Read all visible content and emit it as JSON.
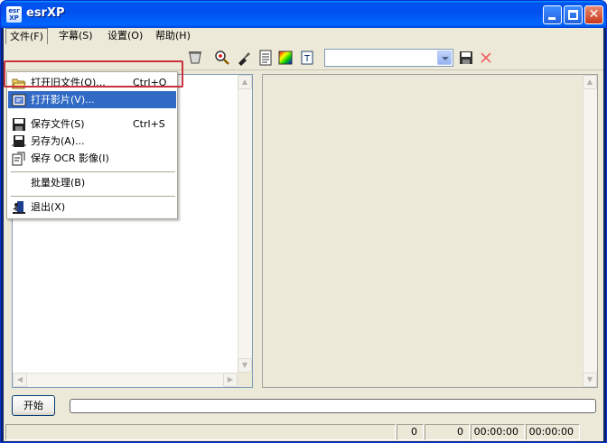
{
  "window": {
    "title": "esrXP",
    "icon_text": "esr XP"
  },
  "menubar": {
    "items": [
      {
        "label": "文件(F)"
      },
      {
        "label": "字幕(S)"
      },
      {
        "label": "设置(O)"
      },
      {
        "label": "帮助(H)"
      }
    ]
  },
  "toolbar": {
    "icons": [
      "clear-icon",
      "zoom-in-icon",
      "brush-icon",
      "document-icon",
      "color-icon",
      "text-icon"
    ],
    "combo_value": "",
    "save_icon": "save-icon",
    "delete_icon": "delete-icon"
  },
  "file_menu": {
    "items": [
      {
        "label": "打开旧文件(O)...",
        "shortcut": "Ctrl+O",
        "icon": "open-folder-icon"
      },
      {
        "label": "打开影片(V)...",
        "shortcut": "",
        "icon": "open-movie-icon",
        "selected": true
      },
      {
        "label": "保存文件(S)",
        "shortcut": "Ctrl+S",
        "icon": "save-icon"
      },
      {
        "label": "另存为(A)...",
        "shortcut": "",
        "icon": "save-as-icon"
      },
      {
        "label": "保存 OCR 影像(I)",
        "shortcut": "",
        "icon": "ocr-image-icon"
      },
      {
        "label": "批量处理(B)",
        "shortcut": "",
        "icon": ""
      },
      {
        "label": "退出(X)",
        "shortcut": "",
        "icon": "exit-icon"
      }
    ]
  },
  "controls": {
    "start_label": "开始",
    "progress": 0
  },
  "status": {
    "cells": [
      "",
      "0",
      "0",
      "00:00:00",
      "00:00:00"
    ]
  },
  "colors": {
    "title_blue": "#0054E3",
    "menu_highlight": "#316AC5",
    "annotation_red": "#C8323C"
  }
}
